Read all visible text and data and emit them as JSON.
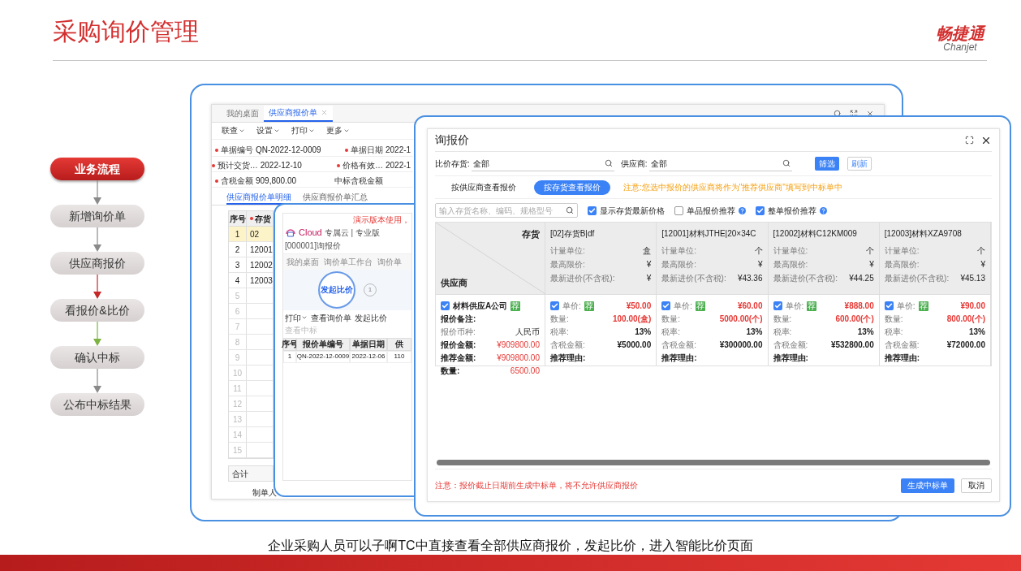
{
  "slide": {
    "title": "采购询价管理",
    "logo_mark": "畅捷通",
    "logo_latin": "Chanjet",
    "caption": "企业采购人员可以子啊TC中直接查看全部供应商报价，发起比价，进入智能比价页面"
  },
  "flow": [
    {
      "label": "业务流程",
      "selected": true,
      "color": "#8a8a8a"
    },
    {
      "label": "新增询价单",
      "selected": false,
      "color": "#8a8a8a"
    },
    {
      "label": "供应商报价",
      "selected": false,
      "color": "#c62828"
    },
    {
      "label": "看报价&比价",
      "selected": false,
      "color": "#7cb342"
    },
    {
      "label": "确认中标",
      "selected": false,
      "color": "#8a8a8a"
    },
    {
      "label": "公布中标结果",
      "selected": false
    }
  ],
  "erp_window": {
    "tabs": [
      {
        "label": "我的桌面",
        "selected": false,
        "closable": false
      },
      {
        "label": "供应商报价单",
        "selected": true,
        "closable": true
      }
    ],
    "menu": [
      "联查",
      "设置",
      "打印",
      "更多"
    ],
    "fields": [
      {
        "label": "单据编号",
        "required": true,
        "value": "QN-2022-12-0009"
      },
      {
        "label": "单据日期",
        "required": true,
        "value": "2022-1"
      },
      {
        "label": "预计交货…",
        "required": true,
        "value": "2022-12-10"
      },
      {
        "label": "价格有效…",
        "required": true,
        "value": "2022-1"
      },
      {
        "label": "含税金额",
        "required": true,
        "value": "909,800.00"
      },
      {
        "label": "中标含税金额",
        "required": false
      }
    ],
    "detail_tabs": [
      {
        "label": "供应商报价单明细",
        "selected": true
      },
      {
        "label": "供应商报价单汇总",
        "selected": false
      }
    ],
    "table": {
      "columns": [
        {
          "label": "序号",
          "required": false
        },
        {
          "label": "存货",
          "required": true
        }
      ],
      "rows": [
        {
          "index": "1",
          "code": "02",
          "selected": true
        },
        {
          "index": "2",
          "code": "12001",
          "selected": false
        },
        {
          "index": "3",
          "code": "12002",
          "selected": false
        },
        {
          "index": "4",
          "code": "12003",
          "selected": false
        },
        {
          "index": "5",
          "selected": false
        },
        {
          "index": "6",
          "selected": false
        },
        {
          "index": "7",
          "selected": false
        },
        {
          "index": "8",
          "selected": false
        },
        {
          "index": "9",
          "selected": false
        },
        {
          "index": "10",
          "selected": false
        },
        {
          "index": "11",
          "selected": false
        },
        {
          "index": "12",
          "selected": false
        },
        {
          "index": "13",
          "selected": false
        },
        {
          "index": "14",
          "selected": false
        },
        {
          "index": "15",
          "selected": false
        }
      ]
    },
    "total_label": "合计",
    "creator_label": "制单人"
  },
  "cloud_window": {
    "demo_note": "演示版本使用，",
    "brand": "Cloud",
    "edition": "专属云 | 专业版",
    "doc": "[000001]询报价",
    "tabs": [
      "我的桌面",
      "询价单工作台",
      "询价单"
    ],
    "callout": "发起比价",
    "step": "1",
    "toolbar": [
      {
        "label": "打印",
        "dropdown": true,
        "disabled": false
      },
      {
        "label": "查看询价单",
        "dropdown": false,
        "disabled": false
      },
      {
        "label": "发起比价",
        "dropdown": false,
        "disabled": false
      },
      {
        "label": "查看中标",
        "dropdown": false,
        "disabled": true
      }
    ],
    "table": {
      "columns": [
        "序号",
        "报价单编号",
        "单据日期",
        "供"
      ],
      "rows": [
        [
          "1",
          "QN-2022-12-0009",
          "2022-12-06",
          "110"
        ]
      ]
    }
  },
  "quote_dialog": {
    "title": "询报价",
    "filters": [
      {
        "label": "比价存货:",
        "value": "全部"
      },
      {
        "label": "供应商:",
        "value": "全部"
      }
    ],
    "buttons": [
      {
        "label": "筛选",
        "primary": true
      },
      {
        "label": "刷新",
        "primary": false
      }
    ],
    "view_tabs": [
      {
        "label": "按供应商查看报价",
        "selected": false
      },
      {
        "label": "按存货查看报价",
        "selected": true
      }
    ],
    "notice": "注意:您选中报价的供应商将作为\"推荐供应商\"填写到中标单中",
    "search": {
      "placeholder": "输入存货名称、编码、规格型号"
    },
    "options": [
      {
        "label": "显示存货最新价格",
        "checked": true,
        "help": false
      },
      {
        "label": "单品报价推荐",
        "checked": false,
        "help": true
      },
      {
        "label": "整单报价推荐",
        "checked": true,
        "help": true
      }
    ],
    "grid": {
      "corner_top": "存货",
      "corner_bottom": "供应商",
      "items": [
        {
          "title": "[02]存货B|df",
          "rows": [
            {
              "label": "计量单位:",
              "value": "盒"
            },
            {
              "label": "最高限价:",
              "value": "¥"
            },
            {
              "label": "最新进价(不含税):",
              "value": "¥"
            }
          ]
        },
        {
          "title": "[12001]材料JTHE|20×34C",
          "rows": [
            {
              "label": "计量单位:",
              "value": "个"
            },
            {
              "label": "最高限价:",
              "value": "¥"
            },
            {
              "label": "最新进价(不含税):",
              "value": "¥43.36"
            }
          ]
        },
        {
          "title": "[12002]材料C12KM009",
          "rows": [
            {
              "label": "计量单位:",
              "value": "个"
            },
            {
              "label": "最高限价:",
              "value": "¥"
            },
            {
              "label": "最新进价(不含税):",
              "value": "¥44.25"
            }
          ]
        },
        {
          "title": "[12003]材料XZA9708",
          "rows": [
            {
              "label": "计量单位:",
              "value": "个"
            },
            {
              "label": "最高限价:",
              "value": "¥"
            },
            {
              "label": "最新进价(不含税):",
              "value": "¥45.13"
            }
          ]
        }
      ],
      "supplier": {
        "name": "材料供应A公司",
        "checked": true,
        "badge": "荐",
        "rows": [
          {
            "label": "报价备注:",
            "strong": true
          },
          {
            "label": "报价币种:",
            "value": "人民币",
            "strong": false,
            "accent": false
          },
          {
            "label": "报价金额:",
            "value": "¥909800.00",
            "strong": true,
            "accent": true
          },
          {
            "label": "推荐金额:",
            "value": "¥909800.00",
            "strong": true,
            "accent": true
          },
          {
            "label": "数量:",
            "value": "6500.00",
            "strong": true,
            "accent": true
          }
        ]
      },
      "quotes": [
        {
          "checked": true,
          "badge": "荐",
          "price_label": "单价:",
          "price": "¥50.00",
          "rows": [
            {
              "label": "数量:",
              "value": "100.00(盒)",
              "accent": true
            },
            {
              "label": "税率:",
              "value": "13%",
              "accent": false
            },
            {
              "label": "含税金额:",
              "value": "¥5000.00",
              "accent": false
            }
          ],
          "reason_label": "推荐理由:"
        },
        {
          "checked": true,
          "badge": "荐",
          "price_label": "单价:",
          "price": "¥60.00",
          "rows": [
            {
              "label": "数量:",
              "value": "5000.00(个)",
              "accent": true
            },
            {
              "label": "税率:",
              "value": "13%",
              "accent": false
            },
            {
              "label": "含税金额:",
              "value": "¥300000.00",
              "accent": false
            }
          ],
          "reason_label": "推荐理由:"
        },
        {
          "checked": true,
          "badge": "荐",
          "price_label": "单价:",
          "price": "¥888.00",
          "rows": [
            {
              "label": "数量:",
              "value": "600.00(个)",
              "accent": true
            },
            {
              "label": "税率:",
              "value": "13%",
              "accent": false
            },
            {
              "label": "含税金额:",
              "value": "¥532800.00",
              "accent": false
            }
          ],
          "reason_label": "推荐理由:"
        },
        {
          "checked": true,
          "badge": "荐",
          "price_label": "单价:",
          "price": "¥90.00",
          "rows": [
            {
              "label": "数量:",
              "value": "800.00(个)",
              "accent": true
            },
            {
              "label": "税率:",
              "value": "13%",
              "accent": false
            },
            {
              "label": "含税金额:",
              "value": "¥72000.00",
              "accent": false
            }
          ],
          "reason_label": "推荐理由:"
        }
      ]
    },
    "footer_note": "注意：报价截止日期前生成中标单，将不允许供应商报价",
    "actions": [
      {
        "label": "生成中标单",
        "primary": true
      },
      {
        "label": "取消",
        "primary": false
      }
    ]
  }
}
